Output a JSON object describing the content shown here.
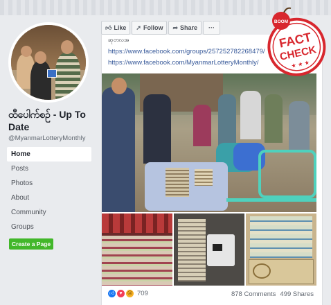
{
  "page": {
    "name": "ထီပေါက်စဉ် - Up To Date",
    "handle": "@MyanmarLotteryMonthly"
  },
  "nav": {
    "items": [
      {
        "label": "Home",
        "active": true
      },
      {
        "label": "Posts",
        "active": false
      },
      {
        "label": "Photos",
        "active": false
      },
      {
        "label": "About",
        "active": false
      },
      {
        "label": "Community",
        "active": false
      },
      {
        "label": "Groups",
        "active": false
      }
    ],
    "create_page_label": "Create a Page"
  },
  "actions": {
    "like_label": "Like",
    "follow_label": "Follow",
    "share_label": "Share",
    "more_label": "···"
  },
  "post": {
    "text_fragment": "ဆုတလအ",
    "links": [
      "https://www.facebook.com/groups/257252782268479/",
      "https://www.facebook.com/MyanmarLotteryMonthly/"
    ],
    "reactions_count": "709",
    "comments": "878 Comments",
    "shares": "499 Shares"
  },
  "stamp": {
    "boom": "BOOM",
    "line1": "FACT",
    "line2": "CHECK",
    "stars": "★ ★ ★",
    "color": "#d8272e"
  },
  "colors": {
    "link": "#365899",
    "create_button": "#42b72a",
    "like_reaction": "#1877f2",
    "love_reaction": "#f33e58",
    "sad_reaction": "#f7b125"
  }
}
